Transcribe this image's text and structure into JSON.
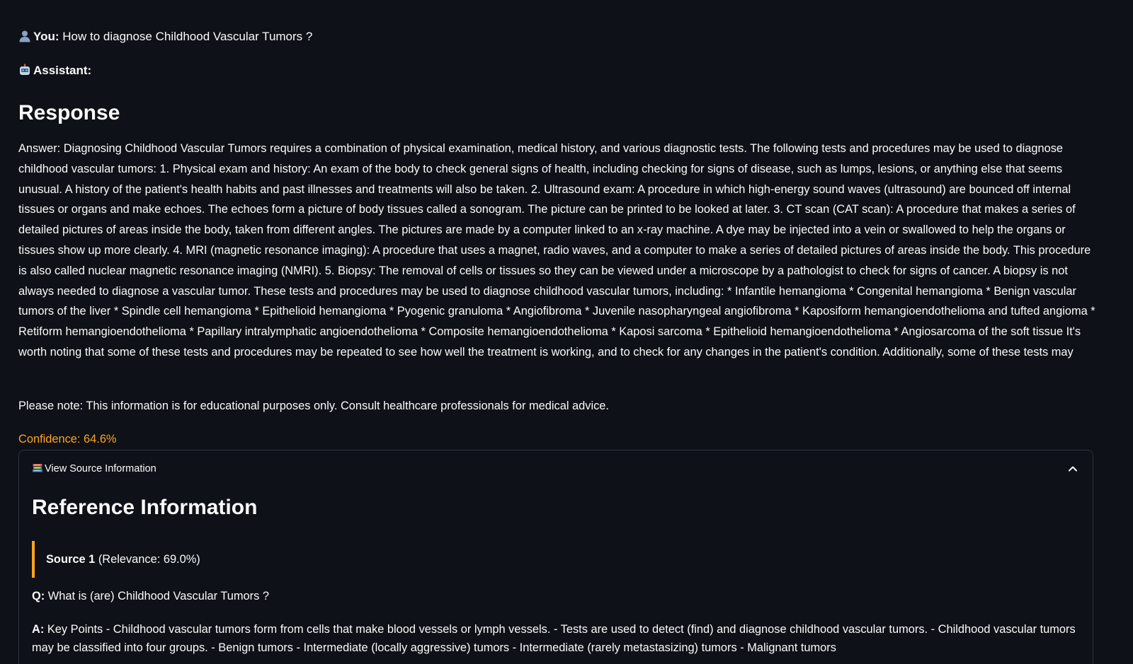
{
  "chat": {
    "user_label": "You:",
    "user_message": "How to diagnose Childhood Vascular Tumors ?",
    "assistant_label": "Assistant:"
  },
  "response": {
    "heading": "Response",
    "answer": "Answer: Diagnosing Childhood Vascular Tumors requires a combination of physical examination, medical history, and various diagnostic tests. The following tests and procedures may be used to diagnose childhood vascular tumors: 1. Physical exam and history: An exam of the body to check general signs of health, including checking for signs of disease, such as lumps, lesions, or anything else that seems unusual. A history of the patient's health habits and past illnesses and treatments will also be taken. 2. Ultrasound exam: A procedure in which high-energy sound waves (ultrasound) are bounced off internal tissues or organs and make echoes. The echoes form a picture of body tissues called a sonogram. The picture can be printed to be looked at later. 3. CT scan (CAT scan): A procedure that makes a series of detailed pictures of areas inside the body, taken from different angles. The pictures are made by a computer linked to an x-ray machine. A dye may be injected into a vein or swallowed to help the organs or tissues show up more clearly. 4. MRI (magnetic resonance imaging): A procedure that uses a magnet, radio waves, and a computer to make a series of detailed pictures of areas inside the body. This procedure is also called nuclear magnetic resonance imaging (NMRI). 5. Biopsy: The removal of cells or tissues so they can be viewed under a microscope by a pathologist to check for signs of cancer. A biopsy is not always needed to diagnose a vascular tumor. These tests and procedures may be used to diagnose childhood vascular tumors, including: * Infantile hemangioma * Congenital hemangioma * Benign vascular tumors of the liver * Spindle cell hemangioma * Epithelioid hemangioma * Pyogenic granuloma * Angiofibroma * Juvenile nasopharyngeal angiofibroma * Kaposiform hemangioendothelioma and tufted angioma * Retiform hemangioendothelioma * Papillary intralymphatic angioendothelioma * Composite hemangioendothelioma * Kaposi sarcoma * Epithelioid hemangioendothelioma * Angiosarcoma of the soft tissue It's worth noting that some of these tests and procedures may be repeated to see how well the treatment is working, and to check for any changes in the patient's condition. Additionally, some of these tests may",
    "note": "Please note: This information is for educational purposes only. Consult healthcare professionals for medical advice.",
    "confidence": "Confidence: 64.6%"
  },
  "sources": {
    "expander_label": "View Source Information",
    "heading": "Reference Information",
    "items": [
      {
        "title": "Source 1",
        "relevance": "(Relevance: 69.0%)",
        "q_label": "Q:",
        "question": "What is (are) Childhood Vascular Tumors ?",
        "a_label": "A:",
        "answer": "Key Points - Childhood vascular tumors form from cells that make blood vessels or lymph vessels. - Tests are used to detect (find) and diagnose childhood vascular tumors. - Childhood vascular tumors may be classified into four groups. - Benign tumors - Intermediate (locally aggressive) tumors - Intermediate (rarely metastasizing) tumors - Malignant tumors"
      }
    ]
  },
  "colors": {
    "background": "#0e1117",
    "text": "#fafafa",
    "accent_orange": "#ffa421",
    "border": "#31333f"
  },
  "icons": {
    "user": "user-silhouette-icon",
    "assistant": "robot-icon",
    "sources": "books-icon",
    "collapse": "chevron-up-icon"
  }
}
